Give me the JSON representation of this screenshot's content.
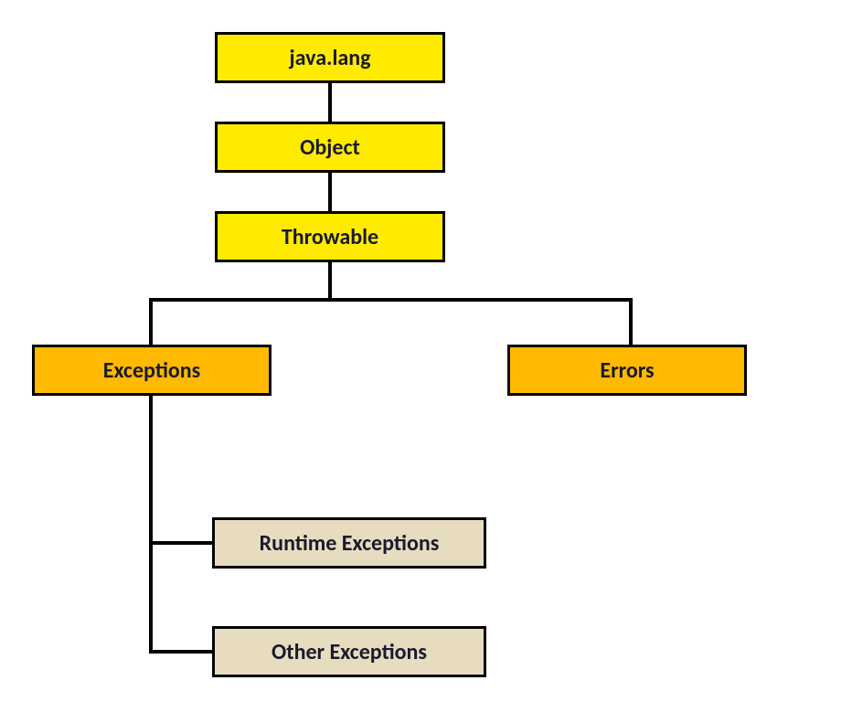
{
  "nodes": {
    "javalang": "java.lang",
    "object": "Object",
    "throwable": "Throwable",
    "exceptions": "Exceptions",
    "errors": "Errors",
    "runtime": "Runtime Exceptions",
    "other": "Other Exceptions"
  }
}
